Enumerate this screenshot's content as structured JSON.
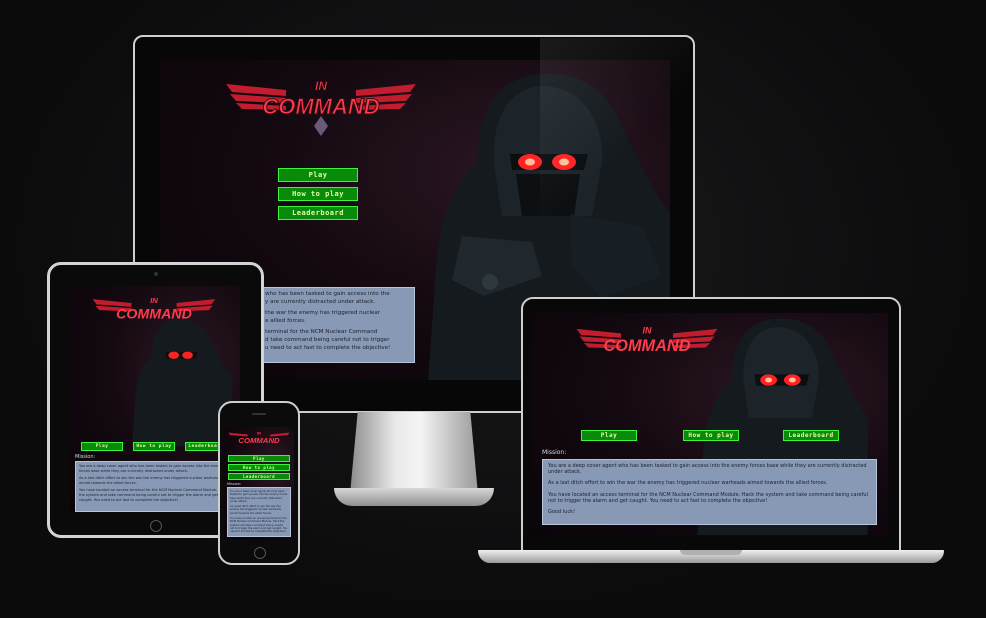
{
  "game": {
    "logo_top": "IN",
    "logo_main": "COMMAND",
    "buttons": {
      "play": "Play",
      "how_to_play": "How to play",
      "leaderboard": "Leaderboard"
    },
    "mission_label": "Mission:",
    "mission": {
      "p1": "You are a deep cover agent who has been tasked to gain access into the enemy forces base while they are currently distracted under attack.",
      "p2": "As a last ditch effort to win the war the enemy has triggered nuclear warheads aimed towards the allied forces.",
      "p3": "You have located an access terminal for the NCM Nuclear Command Module. Hack the system and take command being careful not to trigger the alarm and get caught. You need to act fast to complete the objective!",
      "p4": "Good luck!"
    },
    "desktop_partial": {
      "l1": "who has been tasked to gain access into the",
      "l2": "y are currently distracted under attack.",
      "l3": "the war the enemy has triggered nuclear",
      "l4": "e allied forces.",
      "l5": "terminal for the NCM Nuclear Command",
      "l6": "d take command being careful not to trigger",
      "l7": "u need to act fast to complete the objective!"
    }
  },
  "colors": {
    "button_fill": "#0a8a0a",
    "button_border": "#3ef23e",
    "button_text": "#e4ffa8",
    "logo_red": "#ff3b4c",
    "panel": "#8899b6",
    "eye_red": "#ff2222"
  },
  "icons": [
    "wing-logo-icon",
    "hooded-soldier-figure",
    "camera-dot-icon",
    "home-button-icon"
  ]
}
